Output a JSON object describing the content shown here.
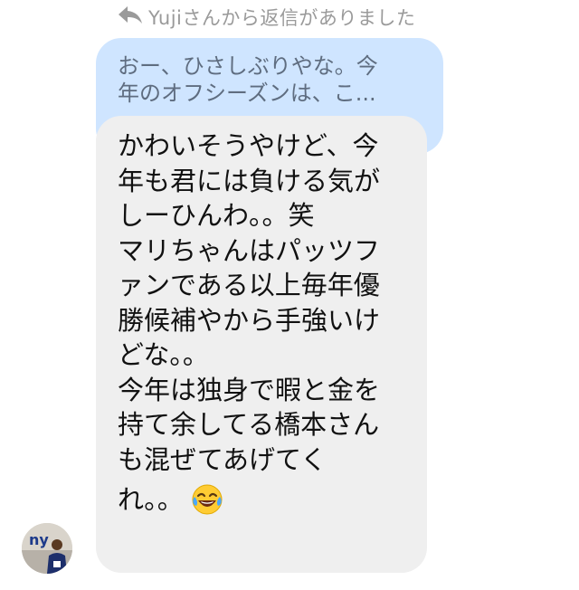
{
  "reply_header": {
    "text": "Yujiさんから返信がありました",
    "icon": "reply-arrow-icon"
  },
  "quoted_message": {
    "lines": [
      "おー、ひさしぶりやな。今",
      "年のオフシーズンは、こ..."
    ]
  },
  "message": {
    "lines": [
      "かわいそうやけど、今",
      "年も君には負ける気が",
      "しーひんわ。。笑",
      "マリちゃんはパッツフ",
      "ァンである以上毎年優",
      "勝候補やから手強いけ",
      "どな。。",
      "今年は独身で暇と金を",
      "持て余してる橋本さん",
      "も混ぜてあげてく"
    ],
    "last_line": "れ。。",
    "emoji": "face-with-tears-of-joy-icon"
  },
  "avatar": {
    "icon": "user-avatar",
    "logo_text": "ny"
  },
  "colors": {
    "quoted_bubble": "#cfe5ff",
    "message_bubble": "#efefef",
    "header_text": "#9a9a9a"
  }
}
